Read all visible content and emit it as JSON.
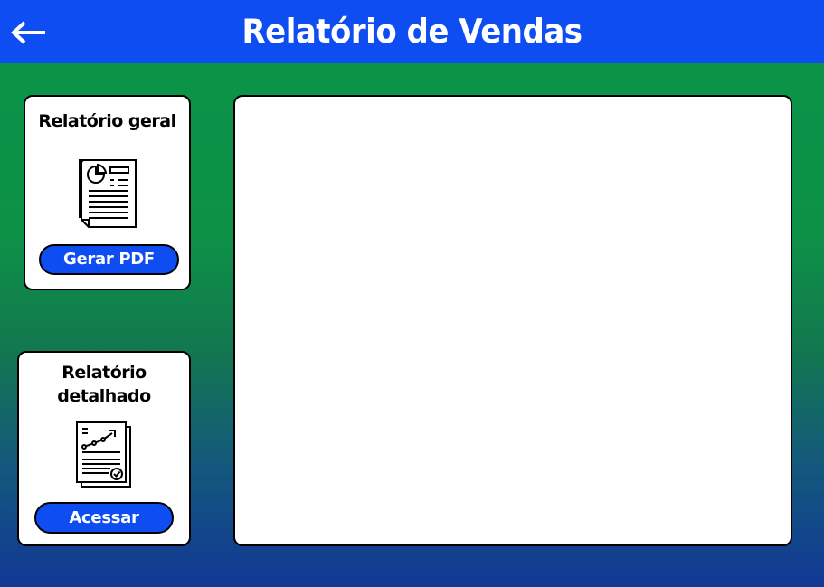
{
  "header": {
    "title": "Relatório de Vendas",
    "back_icon": "arrow-left-icon",
    "background": "#0d4df2"
  },
  "cards": {
    "general": {
      "title": "Relatório geral",
      "icon": "report-document-icon",
      "button_label": "Gerar PDF"
    },
    "detailed": {
      "title_line1": "Relatório",
      "title_line2": "detalhado",
      "icon": "analytics-report-icon",
      "button_label": "Acessar"
    }
  },
  "colors": {
    "accent_blue": "#0d4df2",
    "background_top": "#0a9448",
    "background_bottom": "#123896",
    "card_bg": "#ffffff"
  }
}
